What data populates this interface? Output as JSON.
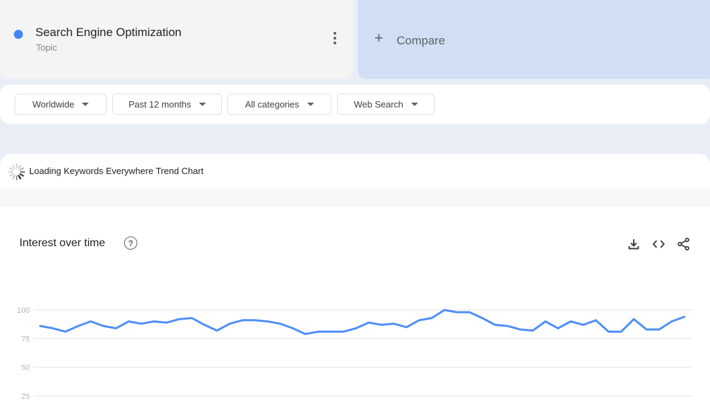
{
  "term": {
    "title": "Search Engine Optimization",
    "subtitle": "Topic",
    "color": "#4285f4",
    "menu_icon": "more-vert-icon"
  },
  "compare": {
    "icon": "plus-icon",
    "label": "Compare"
  },
  "filters": [
    {
      "label": "Worldwide"
    },
    {
      "label": "Past 12 months"
    },
    {
      "label": "All categories"
    },
    {
      "label": "Web Search"
    }
  ],
  "loading": {
    "icon": "spinner-icon",
    "text": "Loading Keywords Everywhere Trend Chart"
  },
  "interest": {
    "title": "Interest over time",
    "help_icon": "help-icon",
    "help_glyph": "?",
    "actions": [
      "download-icon",
      "embed-icon",
      "share-icon"
    ]
  },
  "chart_data": {
    "type": "line",
    "title": "Interest over time",
    "xlabel": "",
    "ylabel": "",
    "ylim": [
      0,
      100
    ],
    "yticks": [
      100,
      75,
      50,
      25
    ],
    "ytick_labels": [
      "100",
      "75",
      "50",
      "25"
    ],
    "grid": true,
    "line_color": "#4f8ef7",
    "series": [
      {
        "name": "Search Engine Optimization",
        "values": [
          86,
          84,
          81,
          86,
          90,
          86,
          84,
          90,
          88,
          90,
          89,
          92,
          93,
          87,
          82,
          88,
          91,
          91,
          90,
          88,
          84,
          79,
          81,
          81,
          81,
          84,
          89,
          87,
          88,
          85,
          91,
          93,
          100,
          98,
          98,
          93,
          87,
          86,
          83,
          82,
          90,
          84,
          90,
          87,
          91,
          81,
          81,
          92,
          83,
          83,
          90,
          94
        ]
      }
    ]
  }
}
